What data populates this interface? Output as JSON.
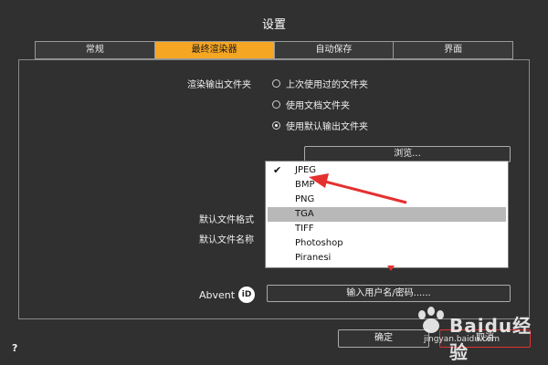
{
  "dialog": {
    "title": "设置"
  },
  "tabs": [
    {
      "label": "常规",
      "active": false
    },
    {
      "label": "最终渲染器",
      "active": true
    },
    {
      "label": "自动保存",
      "active": false
    },
    {
      "label": "界面",
      "active": false
    }
  ],
  "render_output": {
    "label": "渲染输出文件夹",
    "options": [
      {
        "label": "上次使用过的文件夹",
        "checked": false
      },
      {
        "label": "使用文档文件夹",
        "checked": false
      },
      {
        "label": "使用默认输出文件夹",
        "checked": true
      }
    ],
    "browse_label": "浏览..."
  },
  "default_format": {
    "label": "默认文件格式"
  },
  "default_name": {
    "label": "默认文件名称"
  },
  "format_dropdown": {
    "options": [
      {
        "label": "JPEG",
        "selected": true
      },
      {
        "label": "BMP",
        "selected": false
      },
      {
        "label": "PNG",
        "selected": false
      },
      {
        "label": "TGA",
        "selected": false,
        "highlighted": true
      },
      {
        "label": "TIFF",
        "selected": false
      },
      {
        "label": "Photoshop",
        "selected": false
      },
      {
        "label": "Piranesi",
        "selected": false
      }
    ]
  },
  "account": {
    "brand": "Abvent",
    "brand_badge": "iD",
    "login_button": "输入用户名/密码......"
  },
  "footer": {
    "help": "?",
    "ok_button": "确定",
    "cancel_button": "取消"
  },
  "watermark": {
    "text": "Baidu经验",
    "url": "jingyan.baidu.com"
  },
  "colors": {
    "accent": "#f5a623",
    "annotation": "#e53030",
    "background": "#303030"
  }
}
